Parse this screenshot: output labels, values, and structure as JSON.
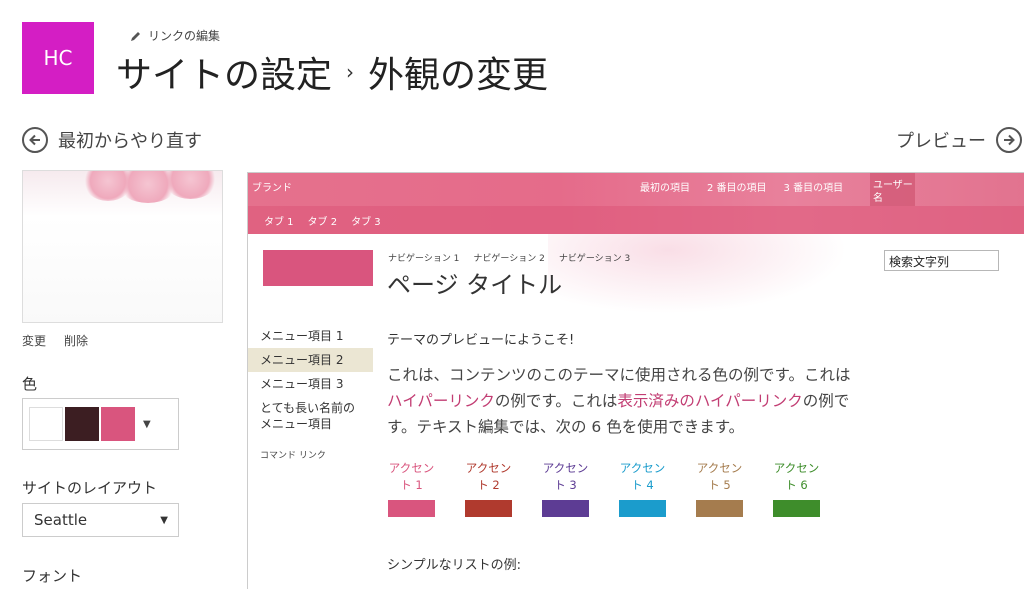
{
  "header": {
    "logo_text": "HC",
    "logo_color": "#d41ec4",
    "edit_links_label": "リンクの編集",
    "title_part1": "サイトの設定",
    "title_separator": "›",
    "title_part2": "外観の変更"
  },
  "navigation": {
    "start_over_label": "最初からやり直す",
    "preview_label": "プレビュー"
  },
  "settings": {
    "background_actions": {
      "change": "変更",
      "delete": "削除"
    },
    "color_label": "色",
    "color_swatches": [
      "#ffffff",
      "#3c1e22",
      "#d9557e"
    ],
    "layout_label": "サイトのレイアウト",
    "layout_value": "Seattle",
    "font_label": "フォント"
  },
  "preview": {
    "brand": "ブランド",
    "top_nav": [
      "最初の項目",
      "2 番目の項目",
      "3 番目の項目"
    ],
    "user_name": "ユーザー名",
    "tabs": [
      "タブ 1",
      "タブ 2",
      "タブ 3"
    ],
    "breadcrumb_nav": [
      "ナビゲーション 1",
      "ナビゲーション 2",
      "ナビゲーション 3"
    ],
    "page_title": "ページ タイトル",
    "search_value": "検索文字列",
    "quick_launch": [
      "メニュー項目 1",
      "メニュー項目 2",
      "メニュー項目 3",
      "とても長い名前のメニュー項目"
    ],
    "quick_launch_selected": 1,
    "command_link": "コマンド リンク",
    "welcome": "テーマのプレビューにようこそ!",
    "text_part1": "これは、コンテンツのこのテーマに使用される色の例です。これは",
    "hyperlink": "ハイパーリンク",
    "text_part2": "の例です。これは",
    "visited_link": "表示済みのハイパーリンク",
    "text_part3": "の例です。テキスト編集では、次の 6 色を使用できます。",
    "accents": [
      {
        "label": "アクセント 1",
        "color": "#d9557e"
      },
      {
        "label": "アクセント 2",
        "color": "#b03a2e"
      },
      {
        "label": "アクセント 3",
        "color": "#5d3c94"
      },
      {
        "label": "アクセント 4",
        "color": "#1b9ccc"
      },
      {
        "label": "アクセント 5",
        "color": "#a57c4e"
      },
      {
        "label": "アクセント 6",
        "color": "#3e8d2b"
      }
    ],
    "simple_list_label": "シンプルなリストの例:"
  }
}
